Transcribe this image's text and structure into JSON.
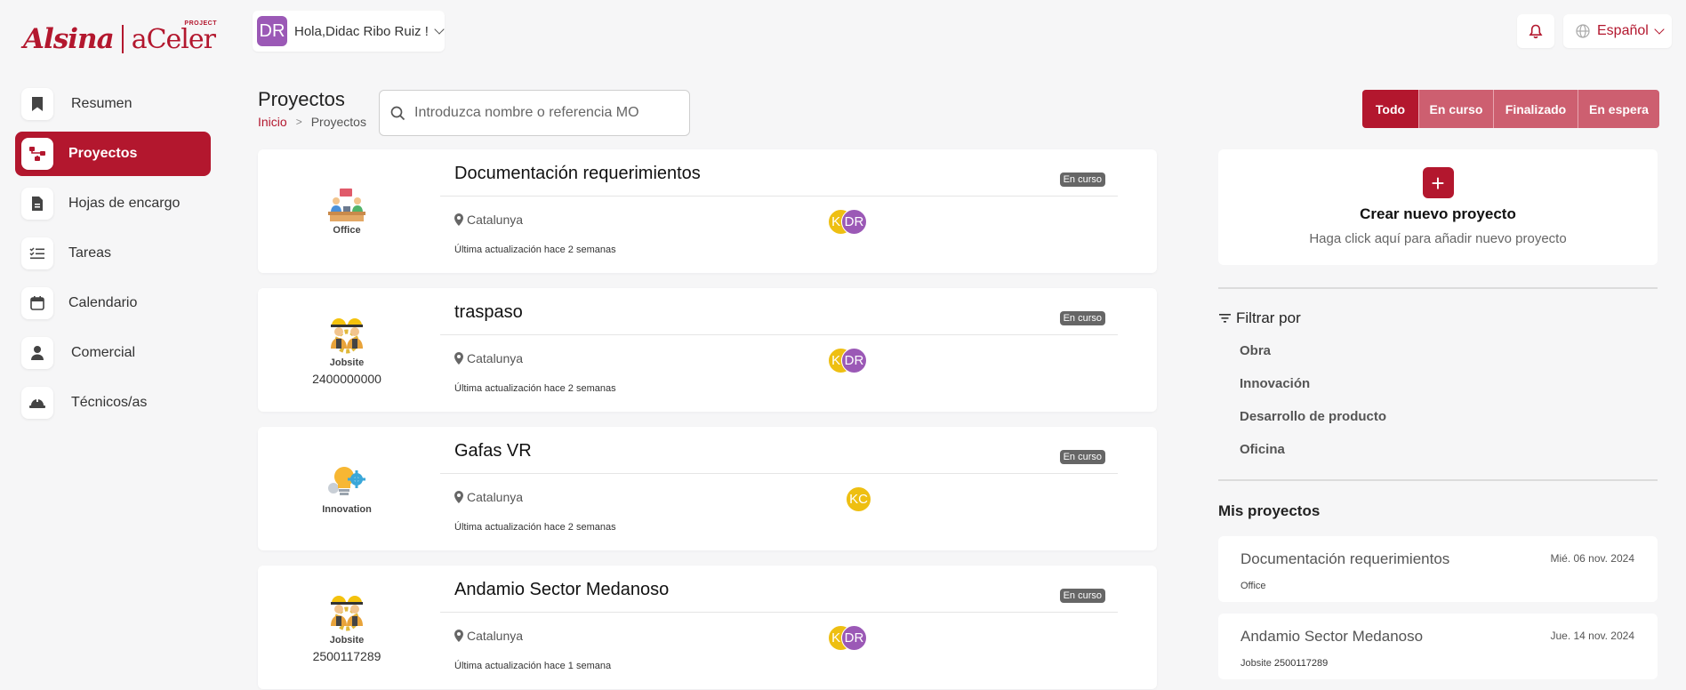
{
  "brand": {
    "name": "Alsina",
    "product": "aCeler",
    "product_tag": "PROJECT",
    "color": "#b3172e"
  },
  "user": {
    "initials": "DR",
    "greeting": "Hola,Didac Ribo Ruiz !"
  },
  "language": {
    "selected": "Español"
  },
  "nav": [
    {
      "label": "Resumen",
      "icon": "bookmark-icon"
    },
    {
      "label": "Proyectos",
      "icon": "project-share-icon",
      "active": true
    },
    {
      "label": "Hojas de encargo",
      "icon": "document-icon"
    },
    {
      "label": "Tareas",
      "icon": "tasks-list-icon"
    },
    {
      "label": "Calendario",
      "icon": "calendar-icon"
    },
    {
      "label": "Comercial",
      "icon": "user-icon"
    },
    {
      "label": "Técnicos/as",
      "icon": "hard-hat-icon"
    }
  ],
  "page": {
    "title": "Proyectos",
    "breadcrumb": {
      "home": "Inicio",
      "separator": ">",
      "current": "Proyectos"
    }
  },
  "search": {
    "placeholder": "Introduzca nombre o referencia MO",
    "value": ""
  },
  "status_filters": [
    {
      "label": "Todo",
      "active": true
    },
    {
      "label": "En curso"
    },
    {
      "label": "Finalizado"
    },
    {
      "label": "En espera"
    }
  ],
  "projects": [
    {
      "title": "Documentación requerimientos",
      "type": "Office",
      "type_icon": "office-icon",
      "reference": "",
      "status": "En curso",
      "location": "Catalunya",
      "updated": "Última actualización hace 2 semanas",
      "members": [
        "KC",
        "DR"
      ]
    },
    {
      "title": "traspaso",
      "type": "Jobsite",
      "type_icon": "workers-icon",
      "reference": "2400000000",
      "status": "En curso",
      "location": "Catalunya",
      "updated": "Última actualización hace 2 semanas",
      "members": [
        "KC",
        "DR"
      ]
    },
    {
      "title": "Gafas VR",
      "type": "Innovation",
      "type_icon": "lightbulb-gear-icon",
      "reference": "",
      "status": "En curso",
      "location": "Catalunya",
      "updated": "Última actualización hace 2 semanas",
      "members": [
        "KC"
      ]
    },
    {
      "title": "Andamio Sector Medanoso",
      "type": "Jobsite",
      "type_icon": "workers-icon",
      "reference": "2500117289",
      "status": "En curso",
      "location": "Catalunya",
      "updated": "Última actualización hace 1 semana",
      "members": [
        "KC",
        "DR"
      ]
    }
  ],
  "new_project": {
    "title": "Crear nuevo proyecto",
    "subtitle": "Haga click aquí para añadir nuevo proyecto"
  },
  "filter_by": {
    "title": "Filtrar por",
    "options": [
      "Obra",
      "Innovación",
      "Desarrollo de producto",
      "Oficina"
    ]
  },
  "my_projects": {
    "title": "Mis proyectos",
    "items": [
      {
        "title": "Documentación requerimientos",
        "date": "Mié. 06 nov. 2024",
        "type": "Office",
        "reference": ""
      },
      {
        "title": "Andamio Sector Medanoso",
        "date": "Jue. 14 nov. 2024",
        "type": "Jobsite",
        "reference": "2500117289"
      }
    ]
  },
  "colors": {
    "accent": "#b3172e",
    "filter_inactive": "#cd5f70",
    "avatar_kc": "#eebf12",
    "avatar_dr": "#9b59b6",
    "badge": "#666666"
  }
}
